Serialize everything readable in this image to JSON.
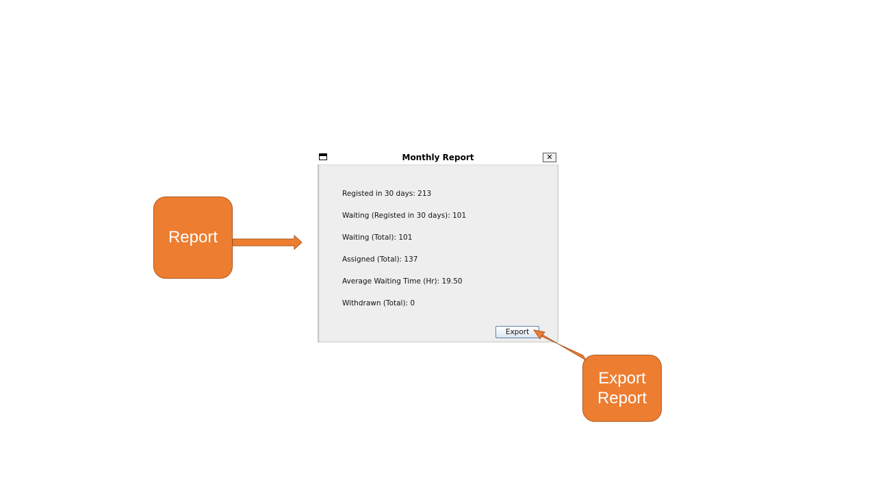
{
  "dialog": {
    "title": "Monthly Report",
    "close_label": "✕",
    "stats": [
      "Registed in 30 days: 213",
      "Waiting (Registed in 30 days): 101",
      "Waiting (Total): 101",
      "Assigned (Total): 137",
      "Average Waiting Time (Hr): 19.50",
      "Withdrawn (Total): 0"
    ],
    "export_label": "Export"
  },
  "callouts": {
    "report_label": "Report",
    "export_line1": "Export",
    "export_line2": "Report"
  },
  "colors": {
    "callout_fill": "#ed7d31",
    "callout_border": "#ae5a21",
    "dialog_bg": "#eeeeee"
  }
}
